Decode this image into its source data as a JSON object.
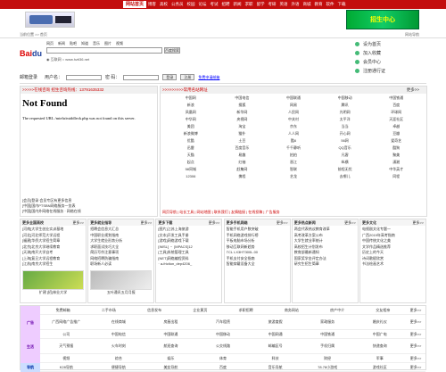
{
  "topbar": {
    "home": "网站首页",
    "items": [
      "博客",
      "高校",
      "公务员",
      "校园",
      "论坛",
      "考试",
      "招聘",
      "新闻",
      "求职",
      "留学",
      "考研",
      "英语",
      "外语",
      "商城",
      "教育",
      "软件",
      "下载",
      "微博",
      "网游",
      "设为首页"
    ]
  },
  "banner": {
    "text": "招生中心"
  },
  "breadcrumb": {
    "path": "当前位置 >> 首页",
    "right": "网站导航"
  },
  "search": {
    "tabs": [
      "网页",
      "新闻",
      "贴吧",
      "知道",
      "音乐",
      "图片",
      "视频"
    ],
    "placeholder": "",
    "button": "百度搜索",
    "radio_line": "◉ 互联网  ○ www.hzti36.net"
  },
  "quick_links": [
    {
      "label": "设为首页"
    },
    {
      "label": "加入收藏"
    },
    {
      "label": "会员中心"
    },
    {
      "label": "注册通行证"
    }
  ],
  "login": {
    "title": "邮箱登录",
    "user_label": "用户名：",
    "pass_label": "密 码：",
    "btn_login": "登录",
    "btn_register": "注册",
    "link": "免费申请邮箱"
  },
  "left_panel": {
    "header": ">>>>>在线咨询 招生咨询热线：13791635332",
    "error_title": "Not Found",
    "error_text": "The requested URL /mtelu/middleck.php was not found on this server.",
    "links": [
      "[会员]登录 会员专区有更多信息",
      "[中国]国内PTSBN网络服务一览表",
      "[中国]国内外网络在线服务 · 网络在线"
    ]
  },
  "mid_panel": {
    "header": ">>>>>>>>>常用名站网址",
    "more": "更多>>",
    "cells": [
      "中国网",
      "中国电信",
      "中国联通",
      "中国移动",
      "中国铁通",
      "新浪",
      "搜狐",
      "网易",
      "腾讯",
      "百度",
      "凤凰网",
      "新华网",
      "人民网",
      "光明网",
      "环球网",
      "中华网",
      "央视网",
      "中关村",
      "太平洋",
      "天涯社区",
      "美团",
      "淘宝",
      "京东",
      "当当",
      "卓越",
      "新浪微博",
      "猫扑",
      "人人网",
      "开心网",
      "豆瓣",
      "优酷",
      "土豆",
      "酷6",
      "56网",
      "爱奇艺",
      "迅雷",
      "百度音乐",
      "千千静听",
      "QQ音乐",
      "酷狗",
      "天猫",
      "易趣",
      "拍拍",
      "凡客",
      "聚美",
      "起点",
      "红袖",
      "晋江",
      "纵横",
      "潇湘",
      "58同城",
      "赶集网",
      "智联",
      "前程无忧",
      "中华英才",
      "12306",
      "携程",
      "艺龙",
      "去哪儿",
      "同程"
    ],
    "footer": "网页导航 | 站长工具 | 网站地图 | 联系我们 | 友情链接 | 在线投稿 | 广告服务"
  },
  "columns": [
    {
      "title": "更多全国高校",
      "more": "更多>>",
      "items": [
        "[河南]大学生创业实训基地",
        "[河北]河北师范大学远程",
        "[福建]华侨大学招生简章",
        "[北京]北京大学继续教育",
        "[天津]南开大学自考",
        "[上海]复旦大学远程教育",
        "[江苏]南京大学招生"
      ],
      "thumb": "green",
      "caption": "扩建 [招]林业大学"
    },
    {
      "title": "更多就业指导",
      "more": "更多>>",
      "items": [
        "招聘会信息大汇总",
        "中国职业规划指南",
        "大学生就业形势分析",
        "求职面试技巧大全",
        "简历写作注意事项",
        "网络招聘防骗指南",
        "职场新人必读"
      ],
      "thumb": "gray",
      "caption": "五叶通讯五月月报"
    },
    {
      "title": "更多下载",
      "more": "更多>>",
      "items": [
        "[图片]江苏上海旅游",
        "[文本]开发工具手册",
        "[游戏]网络游戏下载",
        "[IMSL] ・ [MPACS]12",
        "[工具]系统管理工具",
        "[NET]网络编程资料",
        "· a-friction_dep4206_"
      ],
      "thumb": "",
      "caption": ""
    },
    {
      "title": "更多手机网络",
      "more": "更多>>",
      "items": [
        "智能手机用户数突破",
        "手机网络游戏排行榜",
        "平板电脑市场分析",
        "移动互联网新趋势",
        "TCL LX3HT300L.00",
        "手机支付安全指南",
        "智能穿戴设备大全"
      ],
      "thumb": "",
      "caption": ""
    },
    {
      "title": "更多热点新闻",
      "more": "更多>>",
      "items": [
        "两会代表热议教育改革",
        "高考改革方案公布",
        "大学生就业率统计",
        "高校招生计划发布",
        "教育部最新通知",
        "国家奖学金评定办法",
        "研究生招生简章"
      ],
      "thumb": "",
      "caption": ""
    },
    {
      "title": "更多文化",
      "more": "更多>>",
      "items": [
        "电视剧文化专题一",
        "广西2019年高考指南",
        "中国传统文化之美",
        "文学作品精选推荐",
        "历史上的今天",
        "诗词歌赋欣赏",
        "书法绘画艺术"
      ],
      "thumb": "",
      "caption": ""
    }
  ],
  "bottom_table": {
    "rows": [
      {
        "label": "",
        "cells": [
          "免费邮箱",
          "二手市场",
          "信息发布",
          "企业黄页",
          "求职招聘",
          "商务网站",
          "房产中介",
          "交友相亲"
        ],
        "more": "更多>>"
      },
      {
        "label": "广告",
        "cells": [
          "广西网络广告推广",
          "在线商城",
          "房屋出租",
          "汽车租赁",
          "旅游度假",
          "家政服务",
          "婚庆礼仪"
        ],
        "more": "更多>>",
        "big": true
      },
      {
        "label": "",
        "cells": [
          "公司",
          "中国电信",
          "中国联通",
          "中国移动",
          "中国网通",
          "中国铁通",
          "中国广电"
        ],
        "more": "更多>>"
      },
      {
        "label": "生活",
        "cells": [
          "天气预报",
          "火车时刻",
          "航班查询",
          "公交线路",
          "邮编区号",
          "手机归属",
          "快递查询"
        ],
        "more": "更多>>",
        "big": true
      },
      {
        "label": "",
        "cells": [
          "视频",
          "综合",
          "娱乐",
          "体育",
          "科技",
          "财经",
          "军事"
        ],
        "more": "更多>>"
      },
      {
        "label": "导航",
        "cells": [
          "K28导航",
          "便捷导航",
          "美女导航",
          "百度",
          "音乐导航",
          "78.78小游戏",
          "游戏社区"
        ],
        "more": "更多>>",
        "blue": true
      }
    ]
  }
}
